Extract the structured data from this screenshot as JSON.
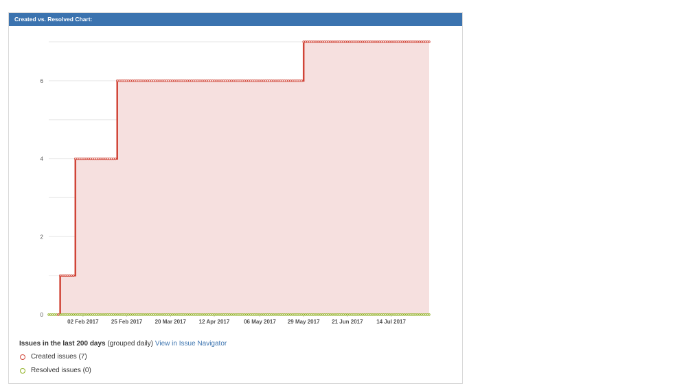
{
  "panel": {
    "title": "Created vs. Resolved Chart:"
  },
  "chart_data": {
    "type": "line",
    "title": "",
    "xlabel": "",
    "ylabel": "",
    "x_range": [
      "2017-01-15",
      "2017-08-03"
    ],
    "ylim": [
      0,
      7
    ],
    "y_ticks": [
      0,
      2,
      4,
      6
    ],
    "x_ticks": [
      {
        "date": "2017-02-02",
        "label": "02 Feb 2017"
      },
      {
        "date": "2017-02-25",
        "label": "25 Feb 2017"
      },
      {
        "date": "2017-03-20",
        "label": "20 Mar 2017"
      },
      {
        "date": "2017-04-12",
        "label": "12 Apr 2017"
      },
      {
        "date": "2017-05-06",
        "label": "06 May 2017"
      },
      {
        "date": "2017-05-29",
        "label": "29 May 2017"
      },
      {
        "date": "2017-06-21",
        "label": "21 Jun 2017"
      },
      {
        "date": "2017-07-14",
        "label": "14 Jul 2017"
      }
    ],
    "grid": true,
    "legend_position": "bottom-left",
    "series": [
      {
        "name": "Created issues",
        "color": "#d04437",
        "fill": "#f6e0df",
        "steps": [
          {
            "date": "2017-01-20",
            "value": 0
          },
          {
            "date": "2017-01-21",
            "value": 1
          },
          {
            "date": "2017-01-29",
            "value": 4
          },
          {
            "date": "2017-02-20",
            "value": 6
          },
          {
            "date": "2017-05-29",
            "value": 7
          }
        ]
      },
      {
        "name": "Resolved issues",
        "color": "#8eb021",
        "steps": [
          {
            "date": "2017-01-15",
            "value": 0
          }
        ]
      }
    ]
  },
  "summary": {
    "heading": "Issues in the last 200 days",
    "note": "(grouped daily)",
    "link": "View in Issue Navigator"
  },
  "legend": {
    "created": "Created issues (7)",
    "resolved": "Resolved issues (0)"
  }
}
